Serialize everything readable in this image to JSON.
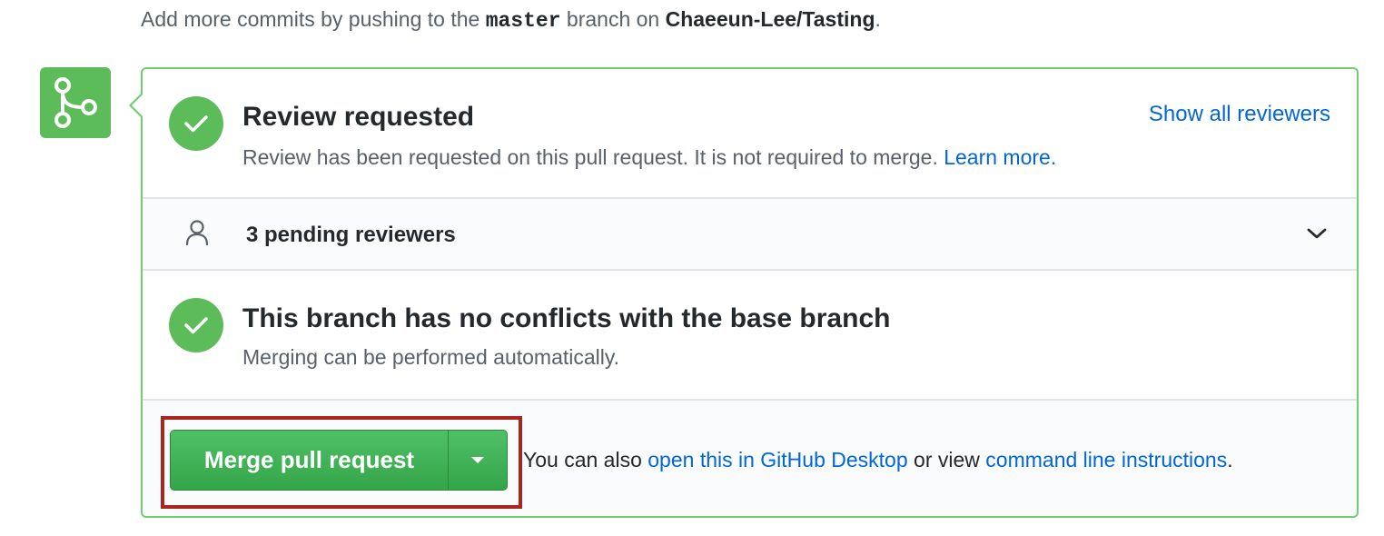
{
  "hint": {
    "prefix": "Add more commits by pushing to the ",
    "branch": "master",
    "middle": " branch on ",
    "repo": "Chaeeun-Lee/Tasting",
    "suffix": "."
  },
  "review": {
    "title": "Review requested",
    "description": "Review has been requested on this pull request. It is not required to merge. ",
    "learn_more": "Learn more.",
    "show_all": "Show all reviewers"
  },
  "pending": {
    "label": "3 pending reviewers"
  },
  "conflicts": {
    "title": "This branch has no conflicts with the base branch",
    "description": "Merging can be performed automatically."
  },
  "merge": {
    "button_label": "Merge pull request",
    "help_prefix": "You can also ",
    "desktop_link": "open this in GitHub Desktop",
    "help_middle": " or view ",
    "cli_link": "command line instructions",
    "help_suffix": "."
  },
  "colors": {
    "success_green": "#5dbc5a",
    "border_green": "#6fcf6f",
    "link_blue": "#0366d6",
    "highlight_red": "#a8261d"
  },
  "icons": {
    "badge": "git-merge-icon",
    "status": "check-icon",
    "reviewers": "person-icon",
    "expand": "chevron-down-icon",
    "dropdown": "triangle-down-icon"
  }
}
